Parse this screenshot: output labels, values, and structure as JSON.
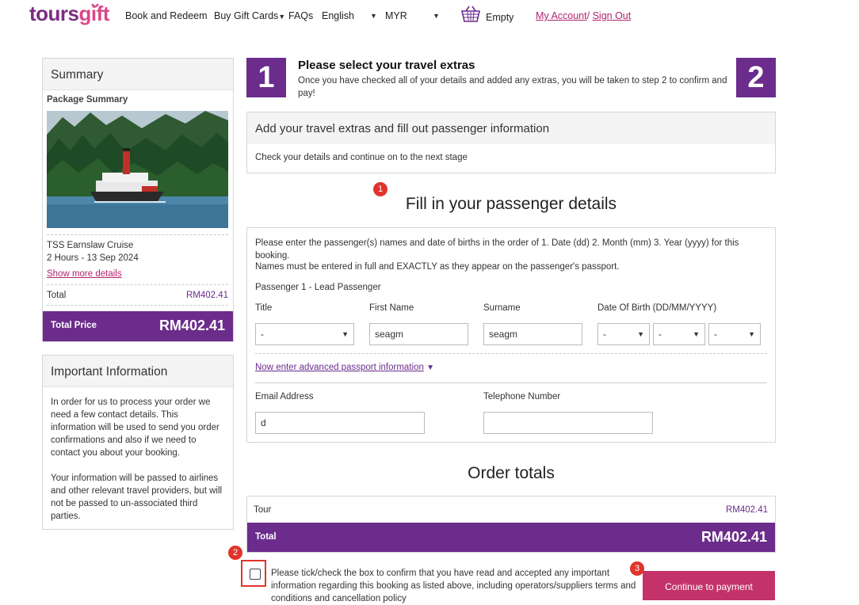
{
  "header": {
    "logo_part1": "tours",
    "logo_part2": "gift",
    "nav": {
      "book_redeem": "Book and Redeem",
      "buy_gift_cards": "Buy Gift Cards",
      "faqs": "FAQs",
      "language": "English",
      "currency": "MYR",
      "cart": "Empty",
      "my_account": "My Account",
      "slash": "/",
      "sign_out": "Sign Out"
    }
  },
  "sidebar": {
    "summary": {
      "title": "Summary",
      "package_summary": "Package Summary",
      "tour_name": "TSS Earnslaw Cruise",
      "tour_detail": "2 Hours - 13 Sep 2024",
      "show_more": "Show more details",
      "total_label": "Total",
      "total_value": "RM402.41",
      "total_price_label": "Total Price",
      "total_price_value": "RM402.41"
    },
    "important": {
      "title": "Important Information",
      "para1": "In order for us to process your order we need a few contact details. This information will be used to send you order confirmations and also if we need to contact you about your booking.",
      "para2": "Your information will be passed to airlines and other relevant travel providers, but will not be passed to un-associated third parties."
    }
  },
  "step": {
    "num1": "1",
    "num2": "2",
    "title": "Please select your travel extras",
    "desc": "Once you have checked all of your details and added any extras, you will be taken to step 2 to confirm and pay!"
  },
  "extras_box": {
    "title": "Add your travel extras and fill out passenger information",
    "subtitle": "Check your details and continue on to the next stage"
  },
  "passenger": {
    "heading": "Fill in your passenger details",
    "instructions1": "Please enter the passenger(s) names and date of births in the order of 1. Date (dd) 2. Month (mm) 3. Year (yyyy) for this booking.",
    "instructions2": "Names must be entered in full and EXACTLY as they appear on the passenger's passport.",
    "lead": "Passenger 1 - Lead Passenger",
    "labels": {
      "title": "Title",
      "first_name": "First Name",
      "surname": "Surname",
      "dob": "Date Of Birth (DD/MM/YYYY)"
    },
    "values": {
      "title": "-",
      "first_name": "seagm",
      "surname": "seagm",
      "dob_day": "-",
      "dob_month": "-",
      "dob_year": "-"
    },
    "passport_link": "Now enter advanced passport information",
    "passport_arrow": "▼",
    "email_label": "Email Address",
    "email_value": "d",
    "phone_label": "Telephone Number",
    "phone_value": ""
  },
  "order": {
    "heading": "Order totals",
    "tour_label": "Tour",
    "tour_value": "RM402.41",
    "total_label": "Total",
    "total_value": "RM402.41"
  },
  "confirm": {
    "checkbox_text": "Please tick/check the box to confirm that you have read and accepted any important information regarding this booking as listed above, including operators/suppliers terms and conditions and cancellation policy",
    "continue_button": "Continue to payment"
  },
  "annotations": {
    "badge1": "1",
    "badge2": "2",
    "badge3": "3"
  },
  "colors": {
    "brand_purple": "#6b2c8c",
    "brand_pink": "#b2246d",
    "continue_button": "#c3336a",
    "annotation_red": "#e0342c"
  }
}
